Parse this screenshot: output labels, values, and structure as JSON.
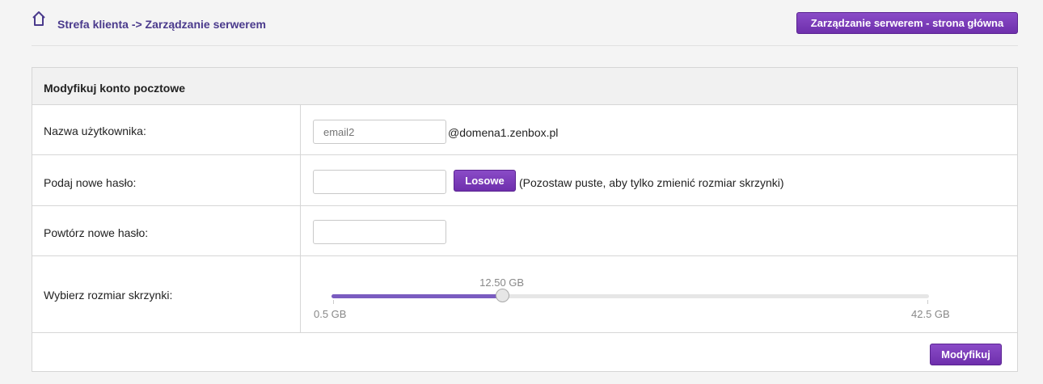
{
  "header": {
    "breadcrumb": "Strefa klienta -> Zarządzanie serwerem",
    "main_button": "Zarządzanie serwerem - strona główna",
    "home_icon": "home-icon"
  },
  "form": {
    "title": "Modyfikuj konto pocztowe",
    "username_label": "Nazwa użytkownika:",
    "username_placeholder": "email2",
    "domain_suffix": "@domena1.zenbox.pl",
    "new_password_label": "Podaj nowe hasło:",
    "random_button": "Losowe",
    "password_hint": "(Pozostaw puste, aby tylko zmienić rozmiar skrzynki)",
    "repeat_password_label": "Powtórz nowe hasło:",
    "mailbox_size_label": "Wybierz rozmiar skrzynki:",
    "submit_button": "Modyfikuj"
  },
  "slider": {
    "value_label": "12.50 GB",
    "min_label": "0.5 GB",
    "max_label": "42.5 GB",
    "min": 0.5,
    "max": 42.5,
    "value": 12.5
  },
  "colors": {
    "accent": "#7a3bbd",
    "slider_fill": "#7a5cc0",
    "link": "#4a3a8c"
  }
}
